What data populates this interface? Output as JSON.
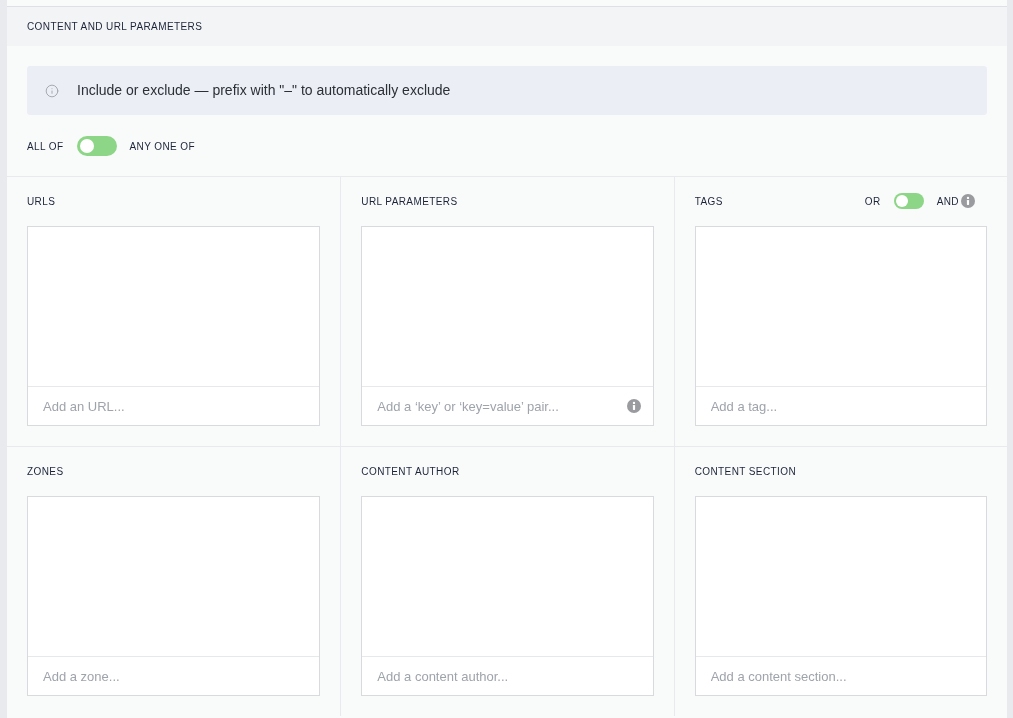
{
  "section": {
    "title": "CONTENT AND URL PARAMETERS"
  },
  "notice": {
    "text": "Include or exclude — prefix with \"–\" to automatically exclude"
  },
  "match_toggle": {
    "left_label": "ALL OF",
    "right_label": "ANY ONE OF",
    "on": false
  },
  "fields": [
    {
      "label": "URLS",
      "placeholder": "Add an URL..."
    },
    {
      "label": "URL PARAMETERS",
      "placeholder": "Add a ‘key’ or ‘key=value’ pair...",
      "info": true
    },
    {
      "label": "TAGS",
      "placeholder": "Add a tag...",
      "toggle": {
        "left_label": "OR",
        "right_label": "AND",
        "on": false,
        "info": true
      }
    },
    {
      "label": "ZONES",
      "placeholder": "Add a zone..."
    },
    {
      "label": "CONTENT AUTHOR",
      "placeholder": "Add a content author..."
    },
    {
      "label": "CONTENT SECTION",
      "placeholder": "Add a content section..."
    }
  ]
}
